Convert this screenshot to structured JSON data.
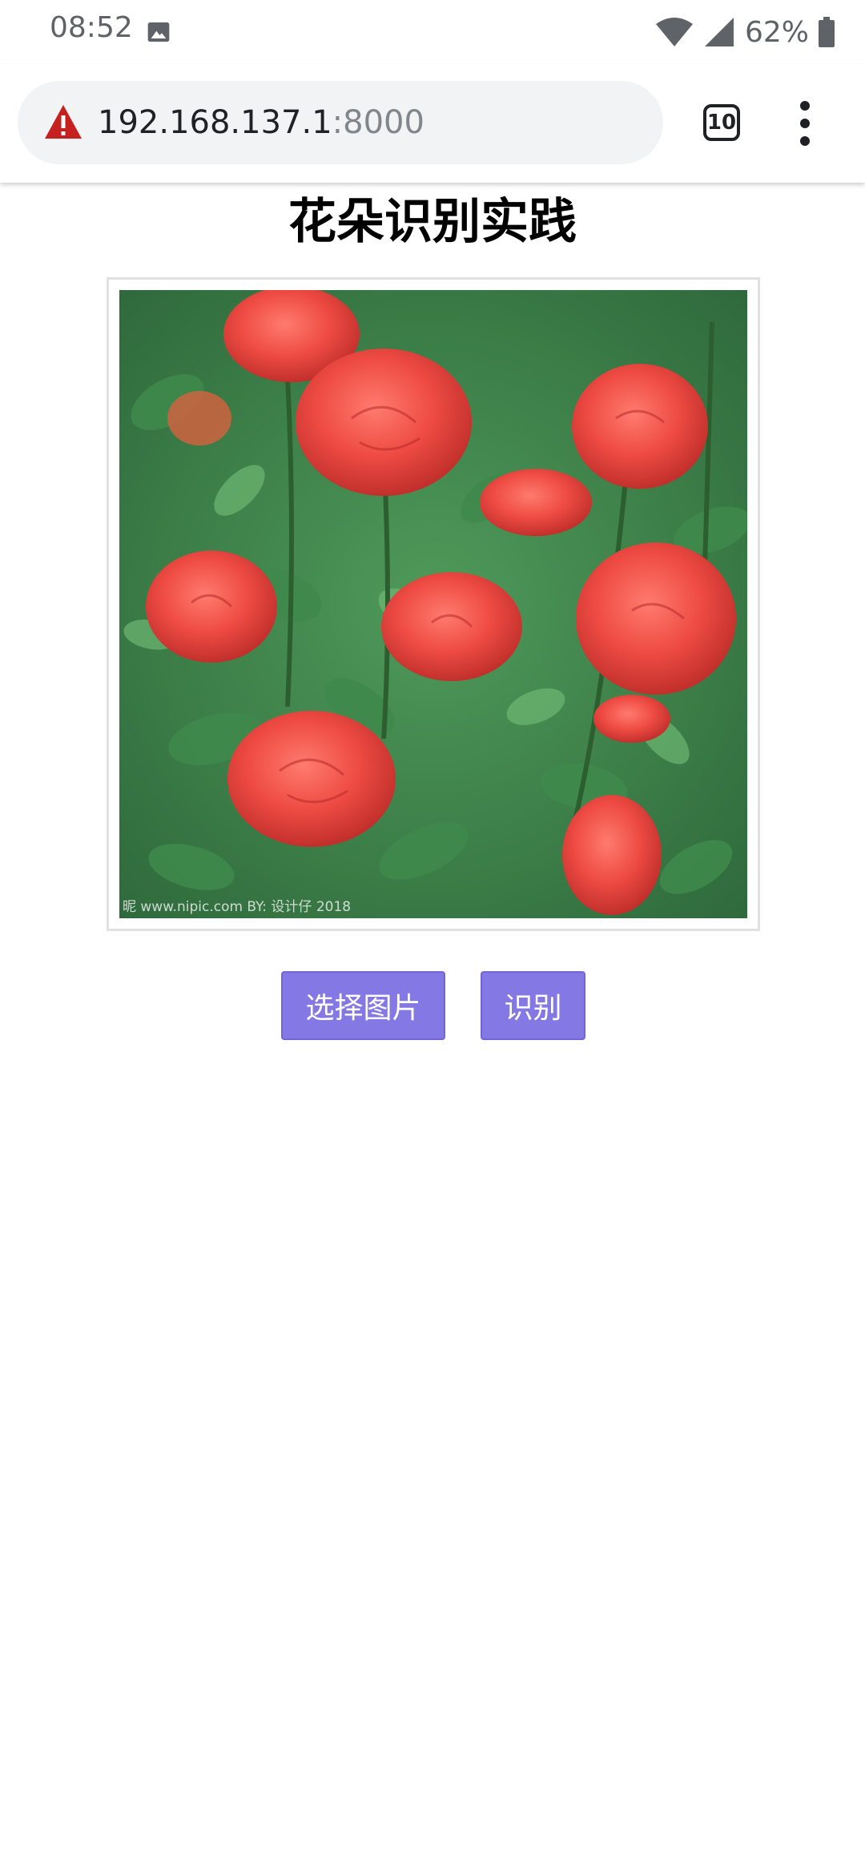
{
  "status_bar": {
    "time": "08:52",
    "battery_percent": "62%",
    "icons": [
      "image-icon",
      "wifi-icon",
      "signal-icon",
      "battery-icon"
    ]
  },
  "browser": {
    "url_host": "192.168.137.1",
    "url_port": ":8000",
    "tab_count": "10",
    "icons": [
      "not-secure-warning-icon",
      "tab-switcher-icon",
      "overflow-menu-icon"
    ]
  },
  "page": {
    "title": "花朵识别实践",
    "image_watermark": "昵 www.nipic.com  BY: 设计仔 2018",
    "select_button_label": "选择图片",
    "recognize_button_label": "识别"
  },
  "colors": {
    "button_bg": "#8479e4",
    "warning_red": "#c5221f",
    "text_primary": "#202124"
  }
}
